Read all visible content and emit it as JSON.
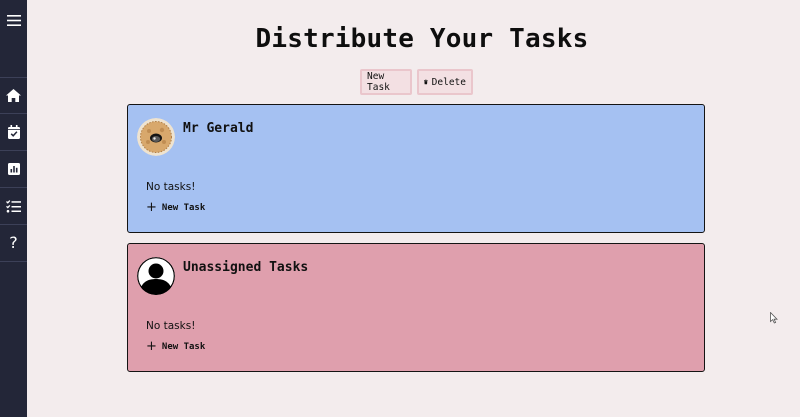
{
  "sidebar": {
    "items": [
      {
        "icon": "menu-icon"
      },
      {
        "icon": "home-icon"
      },
      {
        "icon": "calendar-check-icon"
      },
      {
        "icon": "bar-chart-icon"
      },
      {
        "icon": "checklist-icon"
      },
      {
        "icon": "help-icon",
        "label": "?"
      }
    ]
  },
  "header": {
    "title": "Distribute Your Tasks"
  },
  "toolbar": {
    "new_task_label": "New Task",
    "delete_label": "Delete"
  },
  "cards": [
    {
      "name": "Mr Gerald",
      "empty_text": "No tasks!",
      "add_label": "New Task",
      "color": "#a5c1f2",
      "avatar_icon": "cat-avatar-icon"
    },
    {
      "name": "Unassigned Tasks",
      "empty_text": "No tasks!",
      "add_label": "New Task",
      "color": "#df9fad",
      "avatar_icon": "default-user-avatar-icon"
    }
  ],
  "colors": {
    "sidebar_bg": "#232638",
    "page_bg": "#f3eced",
    "button_bg": "#f3e0e3"
  }
}
